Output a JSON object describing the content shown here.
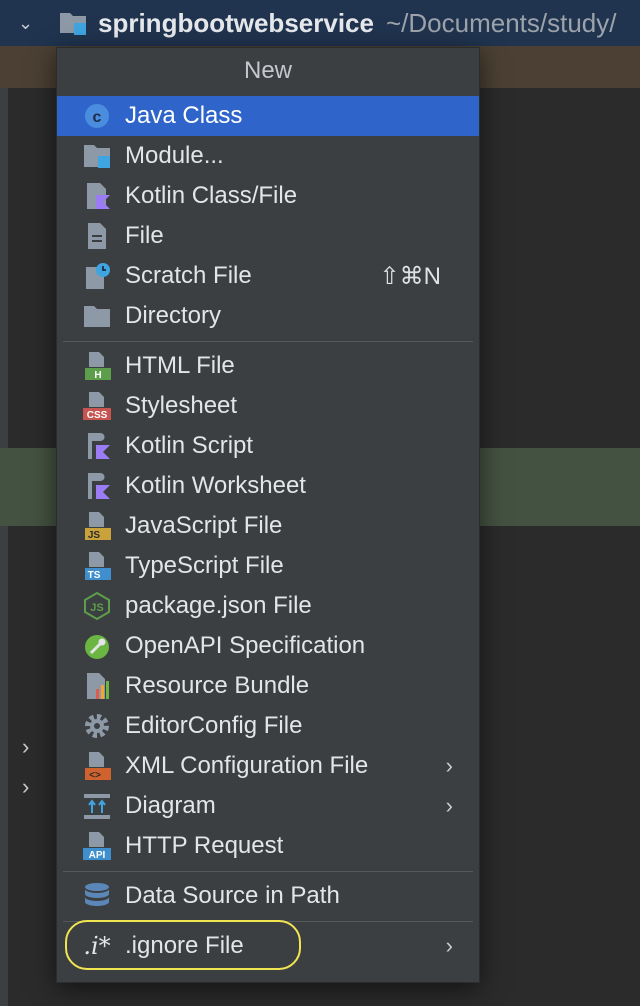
{
  "window": {
    "project_name": "springbootwebservice",
    "project_path": "~/Documents/study/"
  },
  "colors": {
    "menu_bg": "#3c3f41",
    "selected_bg": "#2f65ca",
    "highlight_ring": "#f2e552",
    "title_bar": "#20344f"
  },
  "menu": {
    "title": "New",
    "items": [
      {
        "label": "Java Class",
        "icon": "java-class-icon",
        "selected": true
      },
      {
        "label": "Module...",
        "icon": "module-icon"
      },
      {
        "label": "Kotlin Class/File",
        "icon": "kotlin-file-icon"
      },
      {
        "label": "File",
        "icon": "file-icon"
      },
      {
        "label": "Scratch File",
        "icon": "scratch-file-icon",
        "shortcut": "⇧⌘N"
      },
      {
        "label": "Directory",
        "icon": "directory-icon"
      },
      {
        "label": "HTML File",
        "icon": "html-file-icon",
        "badge": "H"
      },
      {
        "label": "Stylesheet",
        "icon": "css-file-icon",
        "badge": "CSS"
      },
      {
        "label": "Kotlin Script",
        "icon": "kotlin-script-icon"
      },
      {
        "label": "Kotlin Worksheet",
        "icon": "kotlin-worksheet-icon"
      },
      {
        "label": "JavaScript File",
        "icon": "javascript-file-icon",
        "badge": "JS"
      },
      {
        "label": "TypeScript File",
        "icon": "typescript-file-icon",
        "badge": "TS"
      },
      {
        "label": "package.json File",
        "icon": "nodejs-icon"
      },
      {
        "label": "OpenAPI Specification",
        "icon": "openapi-icon"
      },
      {
        "label": "Resource Bundle",
        "icon": "resource-bundle-icon"
      },
      {
        "label": "EditorConfig File",
        "icon": "gear-icon"
      },
      {
        "label": "XML Configuration File",
        "icon": "xml-file-icon",
        "badge": "<>",
        "submenu": true
      },
      {
        "label": "Diagram",
        "icon": "diagram-icon",
        "submenu": true
      },
      {
        "label": "HTTP Request",
        "icon": "api-file-icon",
        "badge": "API"
      },
      {
        "label": "Data Source in Path",
        "icon": "database-icon"
      },
      {
        "label": ".ignore File",
        "icon": "ignore-file-icon",
        "glyph": ".i*",
        "submenu": true
      }
    ]
  }
}
